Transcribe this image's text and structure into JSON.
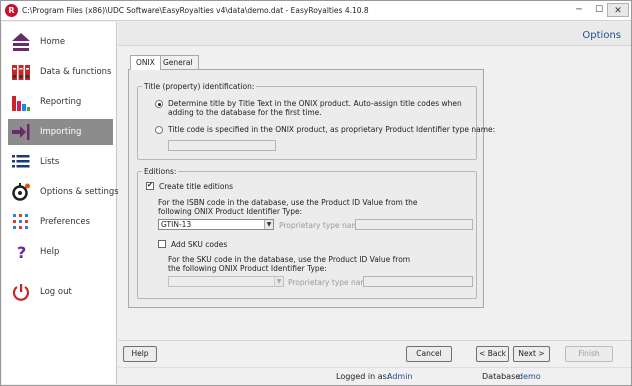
{
  "window": {
    "title": "C:\\Program Files (x86)\\UDC Software\\EasyRoyalties v4\\data\\demo.dat - EasyRoyalties 4.10.8",
    "controls": {
      "minimize": "─",
      "maximize": "☐",
      "close": "✕"
    }
  },
  "sidebar": {
    "items": [
      {
        "label": "Home",
        "icon": "home-icon",
        "active": false
      },
      {
        "label": "Data & functions",
        "icon": "data-functions-icon",
        "active": false
      },
      {
        "label": "Reporting",
        "icon": "reporting-chart-icon",
        "active": false
      },
      {
        "label": "Importing",
        "icon": "import-arrow-icon",
        "active": true
      },
      {
        "label": "Lists",
        "icon": "lists-icon",
        "active": false
      },
      {
        "label": "Options & settings",
        "icon": "settings-gear-icon",
        "active": false
      },
      {
        "label": "Preferences",
        "icon": "preferences-dots-icon",
        "active": false
      },
      {
        "label": "Help",
        "icon": "help-question-icon",
        "active": false
      },
      {
        "label": "Log out",
        "icon": "logout-power-icon",
        "active": false
      }
    ]
  },
  "header": {
    "title": "Options"
  },
  "tabs": [
    {
      "label": "ONIX",
      "active": true
    },
    {
      "label": "General",
      "active": false
    }
  ],
  "onix": {
    "title_group": {
      "label": "Title (property) identification:",
      "option1": "Determine title by Title Text in the ONIX product. Auto-assign title codes when adding to the database for the first time.",
      "option1_selected": true,
      "option2": "Title code is specified in the ONIX product, as proprietary Product Identifier type name:",
      "option2_selected": false,
      "option2_value": ""
    },
    "editions_group": {
      "label": "Editions:",
      "create_title_editions": "Create title editions",
      "create_title_editions_checked": true,
      "isbn_note": "For the ISBN code in the database, use the Product ID Value from the following ONIX Product Identifier Type:",
      "isbn_type": "GTIN-13",
      "proprietary_label": "Proprietary type name:",
      "proprietary_value": "",
      "add_sku": "Add SKU codes",
      "add_sku_checked": false,
      "sku_note": "For the SKU code in the database, use the Product ID Value from the following ONIX Product Identifier Type:",
      "sku_type": "",
      "sku_proprietary_label": "Proprietary type name:",
      "sku_proprietary_value": ""
    }
  },
  "buttons": {
    "help": "Help",
    "cancel": "Cancel",
    "back": "< Back",
    "next": "Next >",
    "finish": "Finish"
  },
  "status": {
    "logged_in_label": "Logged in as:",
    "logged_in_value": "Admin",
    "database_label": "Database:",
    "database_value": "demo"
  },
  "colors": {
    "accent_blue": "#1f4f8f",
    "active_nav": "#8c8c8c",
    "brand_red": "#c8102e"
  }
}
